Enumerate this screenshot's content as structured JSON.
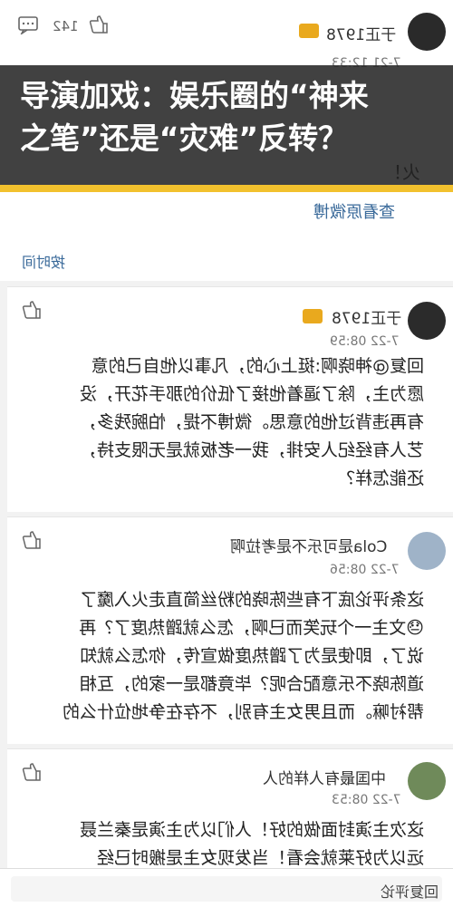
{
  "banner": {
    "title_line1": "导演加戏：娱乐圈的“神来",
    "title_line2": "之笔”还是“灾难”反转？"
  },
  "top_card": {
    "like_count": "142",
    "user_name": "于正1978",
    "time": "7-21 12:33",
    "text_fragment": "火！"
  },
  "top_strip": {
    "view_weibo_link": "查看原微博",
    "sort_label": "按时间"
  },
  "comments": [
    {
      "name": "于正1978",
      "time": "7-22 08:59",
      "lines": [
        "回复@神晓啊:挺上心的，凡事以他自己的意",
        "愿为主，除了逼着他接了低价的那手花开，没",
        "有再违背过他的意思。微博不提，怕腕残多，",
        "艺人有经纪人安排，我一老板就是无限支持，",
        "还能怎样？"
      ]
    },
    {
      "name": "Cola是可乐不是考拉啊",
      "time": "7-22 08:56",
      "lines": [
        "这条评论底下有些陈晓的粉丝简直走火入魔了",
        "😓文主一个玩笑而已啊，怎么就蹭热度了？再",
        "说了，即使是为了蹭热度做宣传，你怎么就知",
        "道陈晓不乐意配合呢？毕竟都是一家的，互相",
        "帮衬嘛。而且男女主有别，不存在争地位什么的"
      ]
    },
    {
      "name": "中国最有人样的人",
      "time": "7-22 08:53",
      "lines": [
        "这次主演封面做的好！人们以为主演是秦兰聂",
        "远以为好莱就会看！当发现女主是搬时已经"
      ]
    }
  ],
  "bottom": {
    "reply_label": "回复评论"
  }
}
